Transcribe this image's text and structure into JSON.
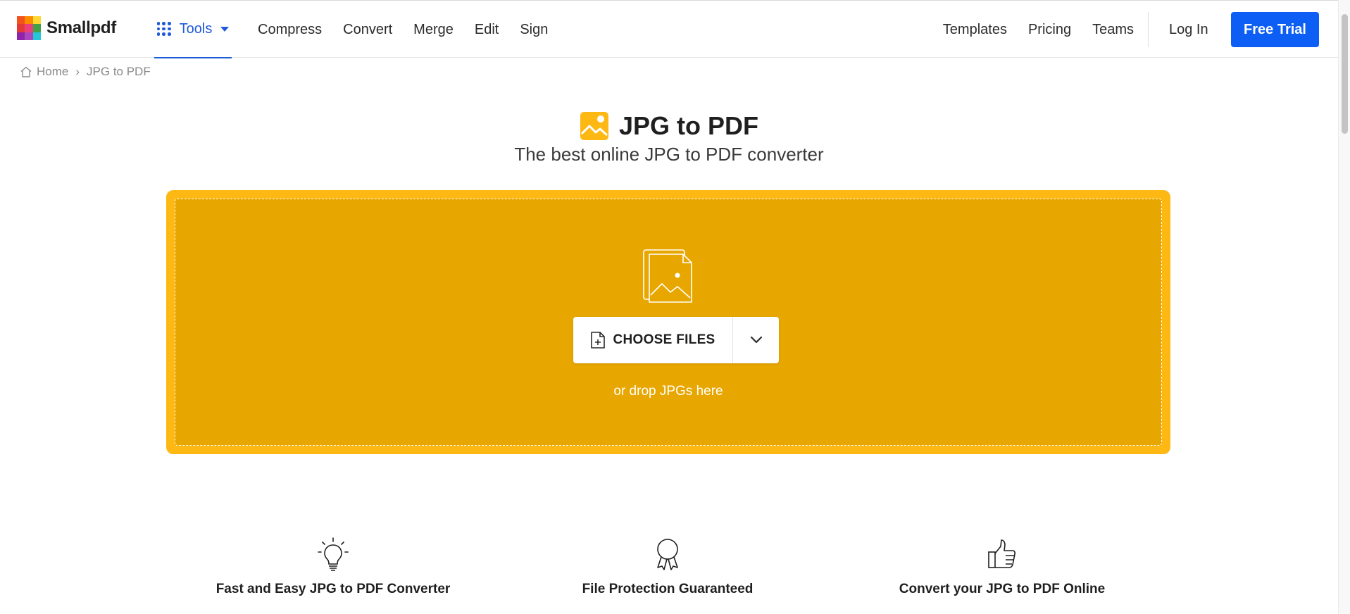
{
  "brand": {
    "name": "Smallpdf",
    "logo_colors": [
      "#f4511e",
      "#fb8c00",
      "#fdd835",
      "#e53935",
      "#ec407a",
      "#43a047",
      "#8e24aa",
      "#ab47bc",
      "#26c6da"
    ]
  },
  "header": {
    "tools_label": "Tools",
    "nav": [
      "Compress",
      "Convert",
      "Merge",
      "Edit",
      "Sign"
    ],
    "right_nav": [
      "Templates",
      "Pricing",
      "Teams"
    ],
    "login_label": "Log In",
    "trial_label": "Free Trial",
    "accent": "#1f5ad9",
    "trial_color": "#0d5ef5"
  },
  "breadcrumb": {
    "home": "Home",
    "separator": "›",
    "current": "JPG to PDF"
  },
  "hero": {
    "title": "JPG to PDF",
    "subtitle": "The best online JPG to PDF converter",
    "icon": "image-icon",
    "accent": "#fdb813"
  },
  "dropzone": {
    "choose_label": "CHOOSE FILES",
    "hint": "or drop JPGs here",
    "outer_color": "#fdb813",
    "inner_color": "#e8a700"
  },
  "features": [
    {
      "icon": "lightbulb-icon",
      "title": "Fast and Easy JPG to PDF Converter"
    },
    {
      "icon": "award-ribbon-icon",
      "title": "File Protection Guaranteed"
    },
    {
      "icon": "thumbs-up-icon",
      "title": "Convert your JPG to PDF Online"
    }
  ]
}
